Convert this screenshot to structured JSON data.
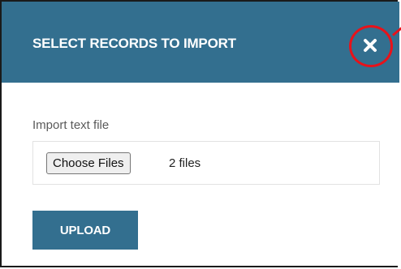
{
  "dialog": {
    "title": "SELECT RECORDS TO IMPORT",
    "close_icon": "close-icon",
    "header_color": "#336f8f",
    "highlight_color": "#e8121a"
  },
  "form": {
    "field_label": "Import text file",
    "choose_files_label": "Choose Files",
    "file_status": "2 files",
    "upload_label": "UPLOAD"
  }
}
